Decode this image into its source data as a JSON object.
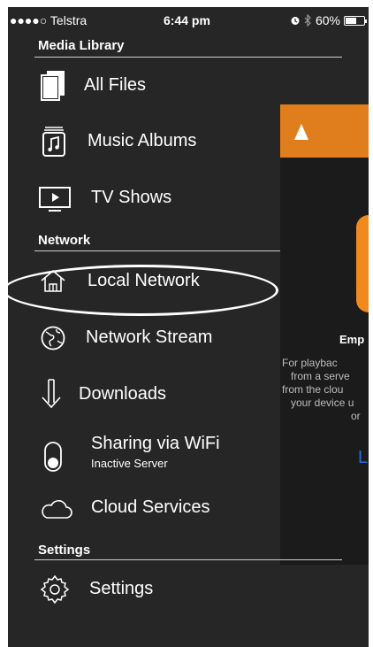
{
  "status_bar": {
    "carrier": "●●●●○ Telstra",
    "time": "6:44 pm",
    "battery": "60%",
    "battery_level": 0.6
  },
  "menu": {
    "media_library": {
      "heading": "Media Library",
      "items": [
        {
          "label": "All Files",
          "icon": "files-icon"
        },
        {
          "label": "Music Albums",
          "icon": "music-album-icon"
        },
        {
          "label": "TV Shows",
          "icon": "tv-icon"
        }
      ]
    },
    "network": {
      "heading": "Network",
      "items": [
        {
          "label": "Local Network",
          "icon": "home-network-icon",
          "highlighted": true
        },
        {
          "label": "Network Stream",
          "icon": "globe-icon"
        },
        {
          "label": "Downloads",
          "icon": "download-arrow-icon"
        },
        {
          "label": "Sharing via WiFi",
          "sublabel": "Inactive Server",
          "icon": "toggle-icon"
        },
        {
          "label": "Cloud Services",
          "icon": "cloud-icon"
        }
      ]
    },
    "settings": {
      "heading": "Settings",
      "items": [
        {
          "label": "Settings",
          "icon": "gear-icon"
        }
      ]
    }
  },
  "background_panel": {
    "empty_title": "Emp",
    "empty_desc_lines": [
      "For playbac",
      "from a serve",
      "from the clou",
      "your device u",
      "or"
    ],
    "link_text": "L"
  },
  "colors": {
    "menu_bg": "#262626",
    "accent_orange": "#e07e1e",
    "link_blue": "#2f6bd8"
  }
}
